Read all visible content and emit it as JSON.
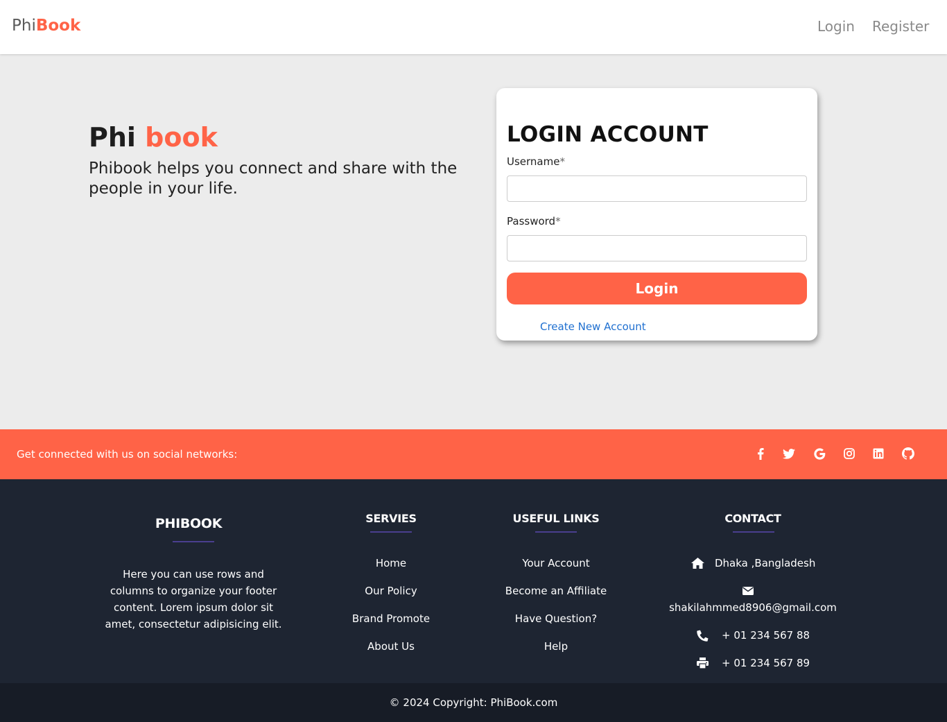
{
  "navbar": {
    "brand_prefix": "Phi",
    "brand_suffix": "Book",
    "login": "Login",
    "register": "Register"
  },
  "hero": {
    "title_prefix": "Phi",
    "title_accent": "book",
    "tagline": "Phibook helps you connect and share with the people in your life."
  },
  "login_card": {
    "title": "LOGIN ACCOUNT",
    "username_label": "Username",
    "password_label": "Password",
    "required_marker": "*",
    "username_value": "",
    "password_value": "",
    "button_label": "Login",
    "create_account": "Create New Account"
  },
  "social": {
    "text": "Get connected with us on social networks:",
    "icons": [
      "facebook-icon",
      "twitter-icon",
      "google-icon",
      "instagram-icon",
      "linkedin-icon",
      "github-icon"
    ]
  },
  "footer": {
    "about": {
      "heading": "PHIBOOK",
      "text": "Here you can use rows and columns to organize your footer content. Lorem ipsum dolor sit amet, consectetur adipisicing elit."
    },
    "services": {
      "heading": "SERVIES",
      "items": [
        "Home",
        "Our Policy",
        "Brand Promote",
        "About Us"
      ]
    },
    "links": {
      "heading": "USEFUL LINKS",
      "items": [
        "Your Account",
        "Become an Affiliate",
        "Have Question?",
        "Help"
      ]
    },
    "contact": {
      "heading": "CONTACT",
      "address": "Dhaka ,Bangladesh",
      "email": "shakilahmmed8906@gmail.com",
      "phone": "+ 01 234 567 88",
      "fax": "+ 01 234 567 89"
    }
  },
  "copyright": "© 2024 Copyright: PhiBook.com",
  "colors": {
    "accent": "#ff6347",
    "footer_bg": "#1e2532",
    "copyright_bg": "#171c26",
    "link": "#1e6fd0",
    "underline": "#4a3f8f"
  }
}
